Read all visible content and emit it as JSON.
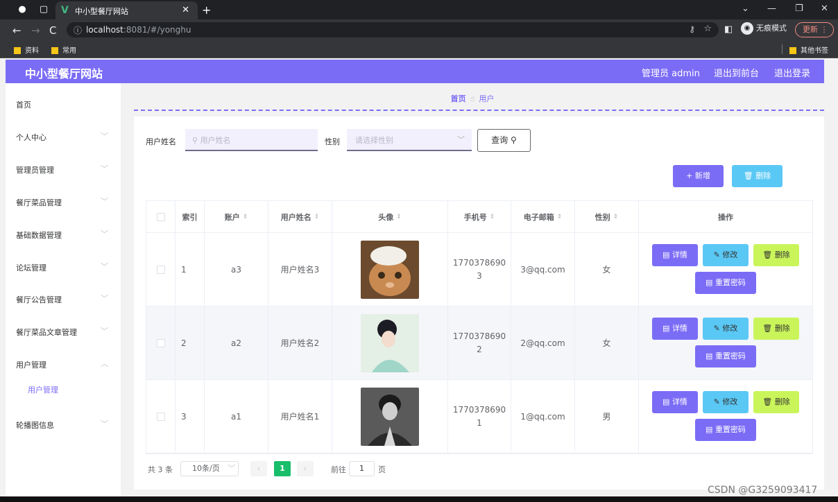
{
  "browser": {
    "tab_title": "中小型餐厅网站",
    "url_host": "localhost",
    "url_rest": ":8081/#/yonghu",
    "incognito_label": "无痕模式",
    "update_label": "更新",
    "bookmarks": [
      "资料",
      "常用",
      "其他书签"
    ]
  },
  "app": {
    "brand": "中小型餐厅网站",
    "top_nav": [
      "管理员 admin",
      "退出到前台",
      "退出登录"
    ],
    "accent": "#7b6cf6"
  },
  "sidebar": {
    "items": [
      "首页",
      "个人中心",
      "管理员管理",
      "餐厅菜品管理",
      "基础数据管理",
      "论坛管理",
      "餐厅公告管理",
      "餐厅菜品文章管理",
      "用户管理",
      "轮播图信息"
    ],
    "sub_item": "用户管理"
  },
  "breadcrumb": {
    "home": "首页",
    "current": "用户"
  },
  "filters": {
    "name_label": "用户姓名",
    "name_placeholder": "用户姓名",
    "gender_label": "性别",
    "gender_placeholder": "请选择性别",
    "query_label": "查询"
  },
  "toolbar": {
    "add_label": "新增",
    "delete_label": "删除"
  },
  "table": {
    "headers": [
      "索引",
      "账户",
      "用户姓名",
      "头像",
      "手机号",
      "电子邮箱",
      "性别",
      "操作"
    ],
    "rows": [
      {
        "index": "1",
        "account": "a3",
        "name": "用户姓名3",
        "phone_a": "1770378690",
        "phone_b": "3",
        "email": "3@qq.com",
        "gender": "女"
      },
      {
        "index": "2",
        "account": "a2",
        "name": "用户姓名2",
        "phone_a": "1770378690",
        "phone_b": "2",
        "email": "2@qq.com",
        "gender": "女"
      },
      {
        "index": "3",
        "account": "a1",
        "name": "用户姓名1",
        "phone_a": "1770378690",
        "phone_b": "1",
        "email": "1@qq.com",
        "gender": "男"
      }
    ],
    "actions": {
      "detail": "详情",
      "edit": "修改",
      "delete": "删除",
      "reset": "重置密码"
    }
  },
  "pagination": {
    "total": "共 3 条",
    "page_size": "10条/页",
    "current_page": "1",
    "goto_label": "前往",
    "goto_value": "1",
    "page_unit": "页"
  },
  "watermark": "CSDN @G3259093417"
}
